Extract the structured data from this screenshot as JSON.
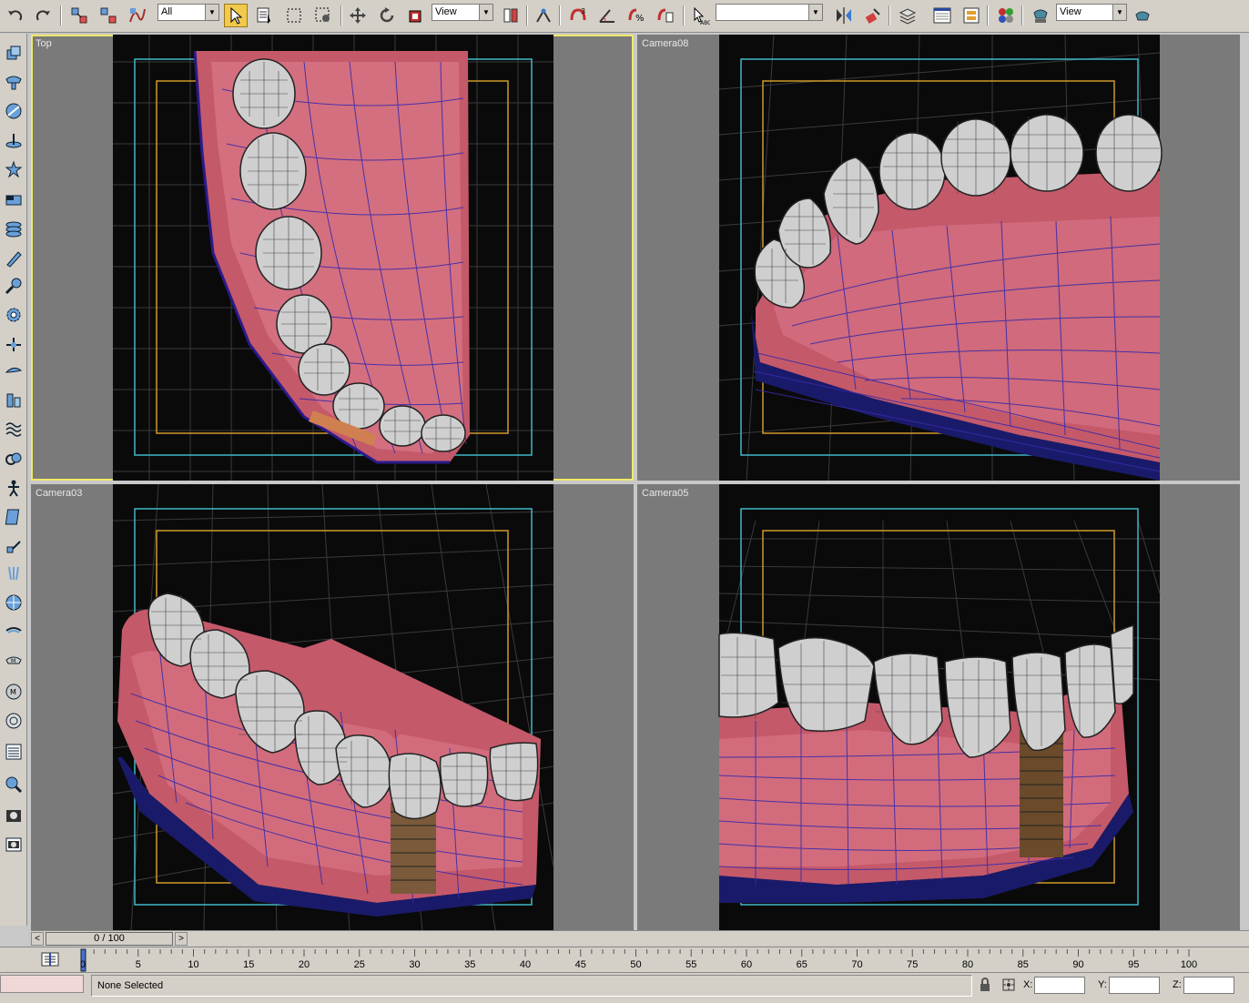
{
  "toolbar": {
    "selection_filter": "All",
    "reference_coord": "View",
    "named_selection": "",
    "render_preset": "View",
    "icons": [
      "undo-icon",
      "redo-icon",
      "select-and-link-icon",
      "unlink-icon",
      "bind-space-warp-icon",
      "select-object-icon",
      "select-by-name-icon",
      "rectangular-selection-icon",
      "window-crossing-icon",
      "select-move-icon",
      "select-rotate-icon",
      "select-scale-icon",
      "reference-coord-icon",
      "pivot-center-icon",
      "select-manipulate-icon",
      "snap-3d-icon",
      "angle-snap-icon",
      "percent-snap-icon",
      "spinner-snap-icon",
      "edit-named-selection-icon",
      "mirror-icon",
      "align-icon",
      "layer-manager-icon",
      "curve-editor-icon",
      "schematic-view-icon",
      "material-editor-icon",
      "render-setup-icon",
      "quick-render-icon"
    ]
  },
  "left_toolbar": {
    "icons": [
      "create-geometry-icon",
      "create-shapes-icon",
      "create-lights-icon",
      "create-cameras-icon",
      "create-helpers-icon",
      "space-warps-icon",
      "systems-icon",
      "modify-icon",
      "hierarchy-icon",
      "motion-icon",
      "display-icon",
      "utilities-icon",
      "object-paint-icon",
      "bones-icon",
      "biped-icon",
      "particle-icon",
      "reactor-icon",
      "cloth-icon",
      "hair-icon",
      "material-icon",
      "mental-ray-icon",
      "light-tracer-icon",
      "schematic-icon",
      "zoom-icon",
      "camera-icon",
      "video-post-icon"
    ]
  },
  "viewports": [
    {
      "label": "Top",
      "active": true
    },
    {
      "label": "Camera08",
      "active": false
    },
    {
      "label": "Camera03",
      "active": false
    },
    {
      "label": "Camera05",
      "active": false
    }
  ],
  "timeline": {
    "left_arrow": "<",
    "frame_display": "0 / 100",
    "right_arrow": ">",
    "ruler_labels": [
      "0",
      "5",
      "10",
      "15",
      "20",
      "25",
      "30",
      "35",
      "40",
      "45",
      "50",
      "55",
      "60",
      "65",
      "70",
      "75",
      "80",
      "85",
      "90",
      "95",
      "100"
    ],
    "current_frame": 0,
    "total_frames": 100
  },
  "status": {
    "text": "None Selected",
    "x_label": "X:",
    "y_label": "Y:",
    "z_label": "Z:",
    "x_value": "",
    "y_value": "",
    "z_value": ""
  },
  "colors": {
    "active_viewport": "#f0e86a",
    "safe_frame_outer": "#3fb8c8",
    "safe_frame_inner": "#d09a2a",
    "gum": "#c45a6a",
    "wire": "#3a2aa8",
    "tooth": "#d8d8d8"
  }
}
